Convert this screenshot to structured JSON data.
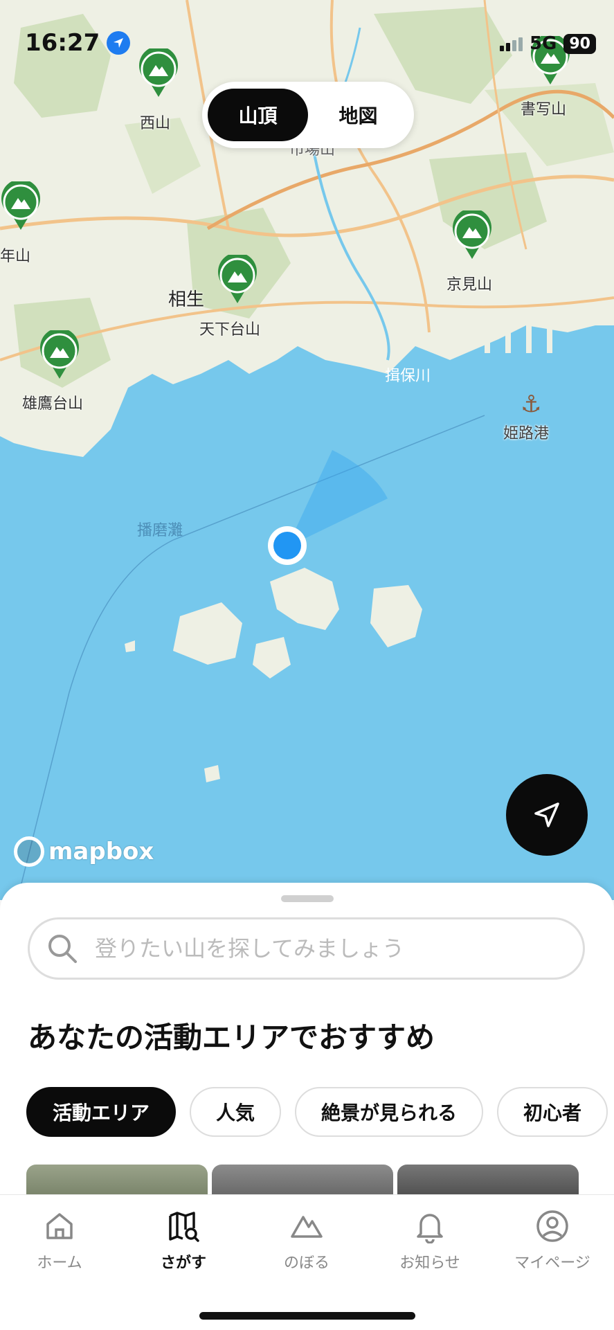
{
  "status": {
    "time": "16:27",
    "network": "5G",
    "battery": "90"
  },
  "segment": {
    "items": [
      "山頂",
      "地図"
    ],
    "selected": "山頂"
  },
  "map": {
    "labels": {
      "nishiyama": "西山",
      "nenyama": "年山",
      "aioi": "相生",
      "tengadaiyama": "天下台山",
      "ontakadaiyama": "雄鷹台山",
      "shoshazan": "書写山",
      "kyomiyama": "京見山",
      "ibogawa": "揖保川",
      "himejiko": "姫路港",
      "harimanada": "播磨灘",
      "ichiba": "市場山"
    },
    "attribution": "mapbox",
    "colors": {
      "sea": "#76c8ec",
      "land": "#eef0e4",
      "pin": "#2f8f3e"
    }
  },
  "sheet": {
    "search_placeholder": "登りたい山を探してみましょう",
    "title": "あなたの活動エリアでおすすめ",
    "chips": [
      "活動エリア",
      "人気",
      "絶景が見られる",
      "初心者"
    ],
    "selected_chip": "活動エリア"
  },
  "tabs": [
    {
      "label": "ホーム",
      "icon": "home-icon"
    },
    {
      "label": "さがす",
      "icon": "map-search-icon"
    },
    {
      "label": "のぼる",
      "icon": "mountain-icon"
    },
    {
      "label": "お知らせ",
      "icon": "bell-icon"
    },
    {
      "label": "マイページ",
      "icon": "profile-icon"
    }
  ],
  "selected_tab": "さがす"
}
